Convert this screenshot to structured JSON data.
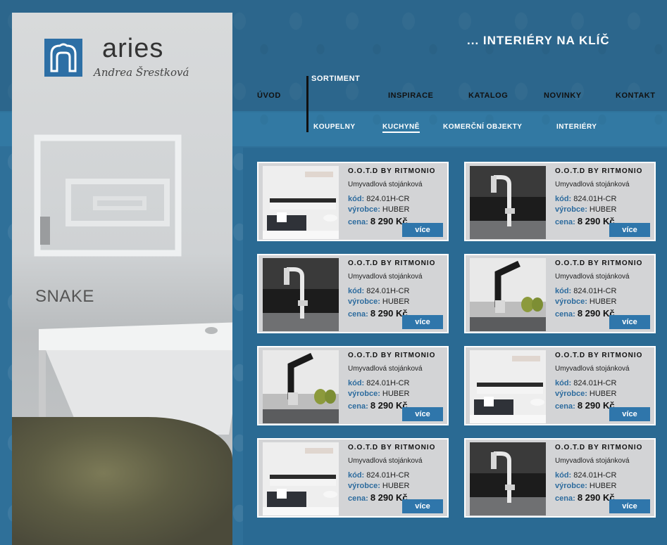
{
  "brand": {
    "name": "aries",
    "owner": "Andrea Šrestková"
  },
  "promo": {
    "label": "SNAKE"
  },
  "header": {
    "tagline": "... INTERIÉRY NA KLÍČ"
  },
  "nav": {
    "main": [
      {
        "label": "ÚVOD"
      },
      {
        "label": "SORTIMENT"
      },
      {
        "label": "INSPIRACE"
      },
      {
        "label": "KATALOG"
      },
      {
        "label": "NOVINKY"
      },
      {
        "label": "KONTAKT"
      }
    ],
    "sub": [
      {
        "label": "KOUPELNY"
      },
      {
        "label": "KUCHYNĚ"
      },
      {
        "label": "KOMERČNÍ OBJEKTY"
      },
      {
        "label": "INTERIÉRY"
      }
    ]
  },
  "labels": {
    "code": "kód:",
    "maker": "výrobce:",
    "price": "cena:",
    "more": "více"
  },
  "products": [
    {
      "title": "O.O.T.D BY RITMONIO",
      "desc": "Umyvadlová stojánková",
      "code": "824.01H-CR",
      "maker": "HUBER",
      "price": "8 290 Kč",
      "image": "bathroom-icon"
    },
    {
      "title": "O.O.T.D BY RITMONIO",
      "desc": "Umyvadlová stojánková",
      "code": "824.01H-CR",
      "maker": "HUBER",
      "price": "8 290 Kč",
      "image": "faucet-icon"
    },
    {
      "title": "O.O.T.D BY RITMONIO",
      "desc": "Umyvadlová stojánková",
      "code": "824.01H-CR",
      "maker": "HUBER",
      "price": "8 290 Kč",
      "image": "faucet-icon"
    },
    {
      "title": "O.O.T.D BY RITMONIO",
      "desc": "Umyvadlová stojánková",
      "code": "824.01H-CR",
      "maker": "HUBER",
      "price": "8 290 Kč",
      "image": "pears-faucet-icon"
    },
    {
      "title": "O.O.T.D BY RITMONIO",
      "desc": "Umyvadlová stojánková",
      "code": "824.01H-CR",
      "maker": "HUBER",
      "price": "8 290 Kč",
      "image": "pears-faucet-icon"
    },
    {
      "title": "O.O.T.D BY RITMONIO",
      "desc": "Umyvadlová stojánková",
      "code": "824.01H-CR",
      "maker": "HUBER",
      "price": "8 290 Kč",
      "image": "bathroom-icon"
    },
    {
      "title": "O.O.T.D BY RITMONIO",
      "desc": "Umyvadlová stojánková",
      "code": "824.01H-CR",
      "maker": "HUBER",
      "price": "8 290 Kč",
      "image": "bathroom-icon"
    },
    {
      "title": "O.O.T.D BY RITMONIO",
      "desc": "Umyvadlová stojánková",
      "code": "824.01H-CR",
      "maker": "HUBER",
      "price": "8 290 Kč",
      "image": "faucet-icon"
    }
  ]
}
